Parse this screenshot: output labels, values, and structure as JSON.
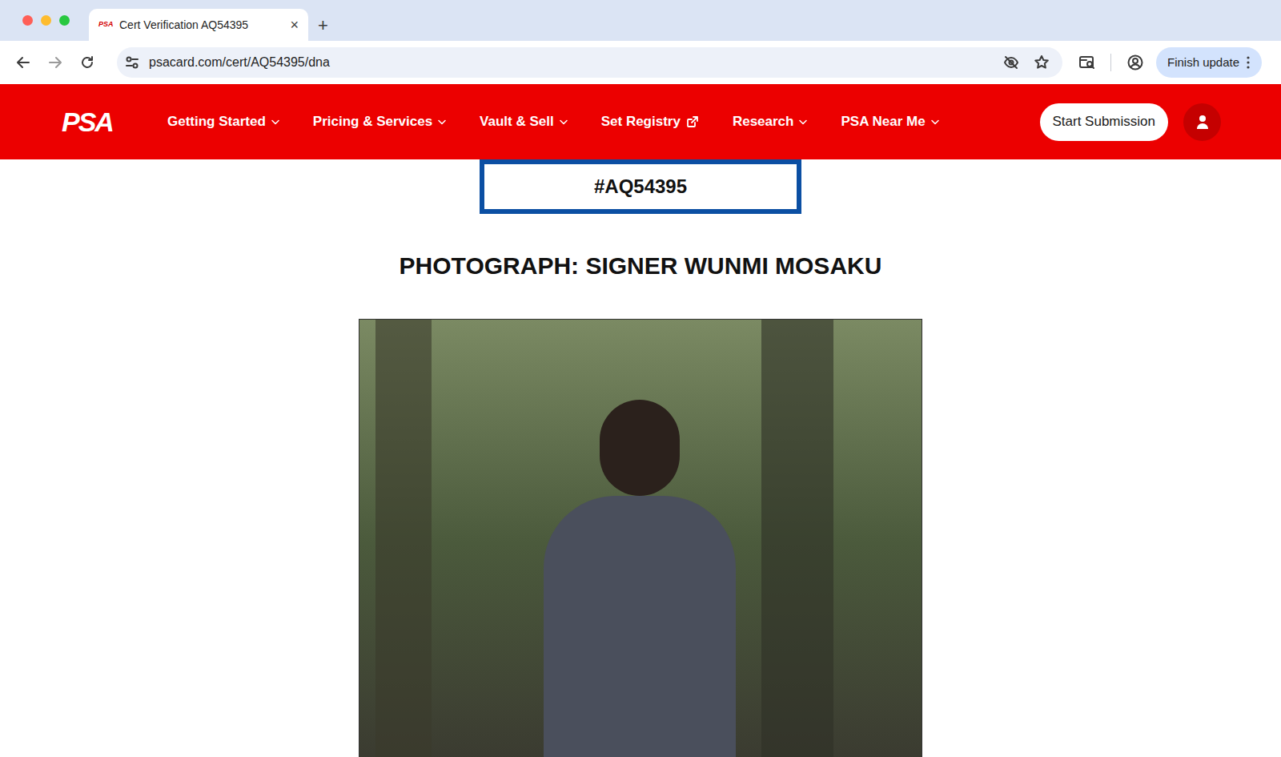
{
  "tabs": [
    {
      "label": "Cert Verification AQ54395",
      "favicon": "PSA",
      "close": "×",
      "selected": true
    }
  ],
  "new_tab": "+",
  "address_bar": {
    "url": "psacard.com/cert/AQ54395/dna"
  },
  "update_button": "Finish update",
  "site_nav": {
    "logo": "PSA",
    "items": [
      {
        "label": "Getting Started",
        "kind": "dropdown"
      },
      {
        "label": "Pricing & Services",
        "kind": "dropdown"
      },
      {
        "label": "Vault & Sell",
        "kind": "dropdown"
      },
      {
        "label": "Set Registry",
        "kind": "external"
      },
      {
        "label": "Research",
        "kind": "dropdown"
      },
      {
        "label": "PSA Near Me",
        "kind": "dropdown"
      }
    ],
    "cta": "Start Submission"
  },
  "cert": {
    "number": "#AQ54395",
    "title": "PHOTOGRAPH: SIGNER WUNMI MOSAKU"
  }
}
